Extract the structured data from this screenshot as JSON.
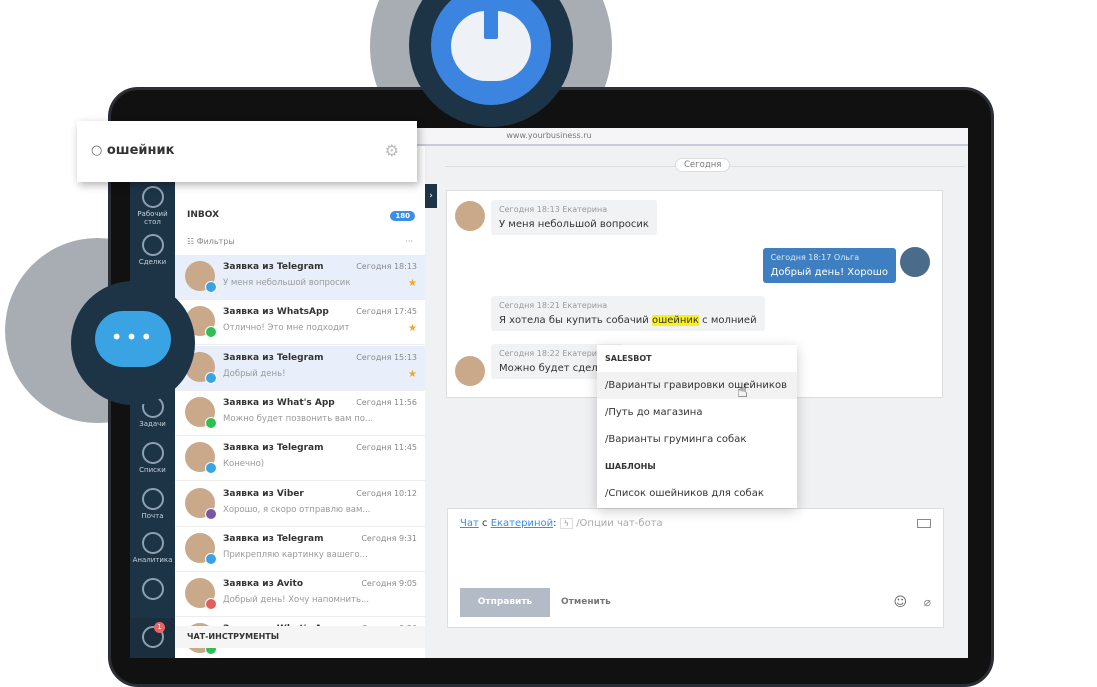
{
  "browser": {
    "url": "www.yourbusiness.ru"
  },
  "search": {
    "query": "ошейник"
  },
  "nav": {
    "items": [
      {
        "label": "Рабочий стол"
      },
      {
        "label": "Сделки"
      },
      {
        "label": "Задачи"
      },
      {
        "label": "Списки"
      },
      {
        "label": "Почта"
      },
      {
        "label": "Аналитика"
      },
      {
        "label": ""
      }
    ],
    "notifications_count": "1"
  },
  "inbox": {
    "title": "INBOX",
    "count": "180",
    "filters": "Фильтры",
    "tools": "ЧАТ-ИНСТРУМЕНТЫ",
    "chats": [
      {
        "title": "Заявка из Telegram",
        "time": "Сегодня 18:13",
        "message": "У меня небольшой вопросик",
        "channel": "telegram",
        "starred": true,
        "selected": true
      },
      {
        "title": "Заявка из WhatsApp",
        "time": "Сегодня 17:45",
        "message": "Отлично! Это мне подходит",
        "channel": "whatsapp",
        "starred": true
      },
      {
        "title": "Заявка из Telegram",
        "time": "Сегодня 15:13",
        "message": "Добрый день!",
        "channel": "telegram",
        "starred": true,
        "selected": true
      },
      {
        "title": "Заявка из What's App",
        "time": "Сегодня 11:56",
        "message": "Можно будет позвонить вам по...",
        "channel": "whatsapp"
      },
      {
        "title": "Заявка из Telegram",
        "time": "Сегодня 11:45",
        "message": "Конечно)",
        "channel": "telegram"
      },
      {
        "title": "Заявка из Viber",
        "time": "Сегодня 10:12",
        "message": "Хорошо, я скоро отправлю вам...",
        "channel": "viber"
      },
      {
        "title": "Заявка из Telegram",
        "time": "Сегодня 9:31",
        "message": "Прикрепляю картинку вашего...",
        "channel": "telegram"
      },
      {
        "title": "Заявка из Avito",
        "time": "Сегодня 9:05",
        "message": "Добрый день! Хочу напомнить...",
        "channel": "avito"
      },
      {
        "title": "Заявка из What's App",
        "time": "Сегодня 8:56",
        "message": "",
        "channel": "whatsapp"
      }
    ]
  },
  "chat": {
    "date": "Сегодня",
    "messages": [
      {
        "meta": "Сегодня 18:13 Екатерина",
        "text": "У меня небольшой вопросик"
      },
      {
        "meta": "Сегодня 18:17 Ольга",
        "text": "Добрый день! Хорошо"
      },
      {
        "meta": "Сегодня 18:21 Екатерина",
        "text_before": "Я хотела бы купить собачий ",
        "highlight": "ошейник",
        "text_after": " с молнией"
      },
      {
        "meta": "Сегодня 18:22 Екатерина",
        "text": "Можно будет сделать"
      }
    ]
  },
  "dropdown": {
    "group1": "SALESBOT",
    "items1": [
      "/Варианты гравировки ошейников",
      "/Путь до магазина",
      "/Варианты груминга собак"
    ],
    "group2": "ШАБЛОНЫ",
    "items2": [
      "/Список ошейников для собак"
    ]
  },
  "composer": {
    "chat_link": "Чат",
    "with": "с",
    "contact": "Екатериной",
    "colon": ":",
    "placeholder": "/Опции чат-бота",
    "send": "Отправить",
    "cancel": "Отменить"
  }
}
